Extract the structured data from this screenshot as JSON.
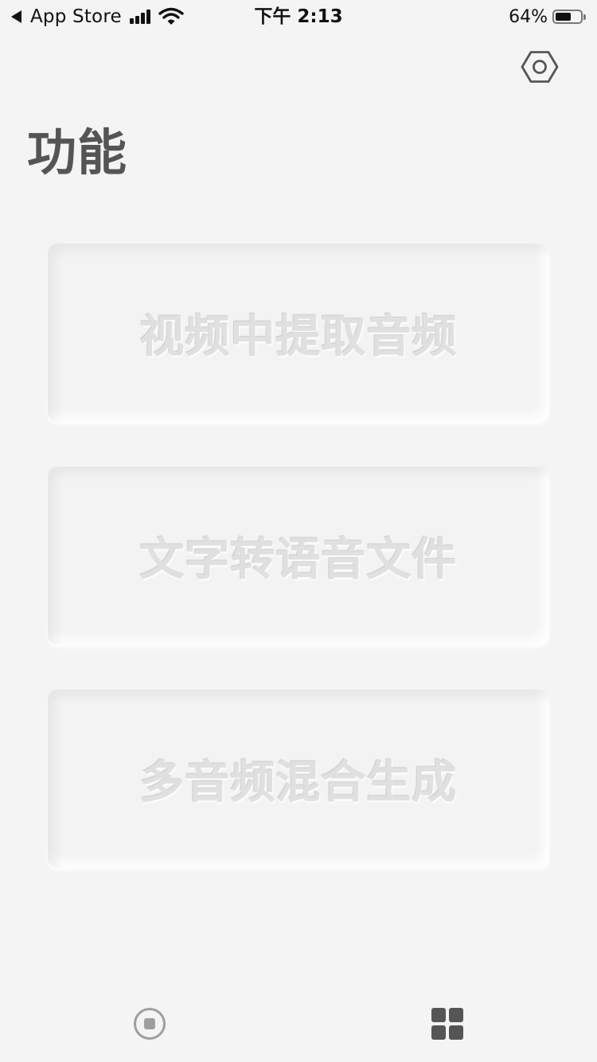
{
  "status_bar": {
    "back_app": "App Store",
    "time": "下午 2:13",
    "battery_percent": "64%",
    "battery_level": 0.64,
    "icons": [
      "back-triangle-icon",
      "signal-icon",
      "wifi-icon",
      "battery-icon"
    ]
  },
  "header": {
    "settings_icon": "hexagon-settings-icon",
    "title": "功能"
  },
  "cards": [
    {
      "label": "视频中提取音频"
    },
    {
      "label": "文字转语音文件"
    },
    {
      "label": "多音频混合生成"
    }
  ],
  "tab_bar": {
    "tabs": [
      {
        "icon": "record-stop-icon",
        "active": false
      },
      {
        "icon": "grid-icon",
        "active": true
      }
    ]
  },
  "colors": {
    "background": "#f4f4f4",
    "title": "#555555",
    "card_text": "#e0e0e0",
    "inactive_tab": "#9e9e9e",
    "active_tab": "#555555"
  }
}
